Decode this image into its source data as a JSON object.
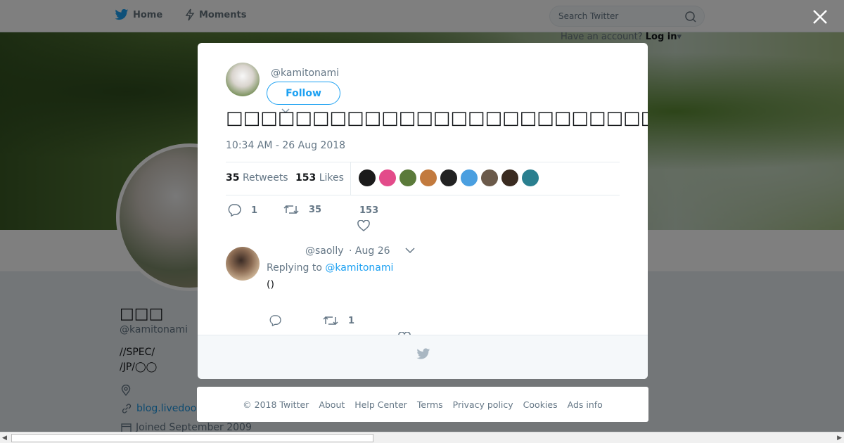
{
  "nav": {
    "home_label": "Home",
    "moments_label": "Moments",
    "search_placeholder": "Search Twitter",
    "have_account": "Have an account?",
    "login_label": "Log in"
  },
  "profile": {
    "name": "□□□",
    "handle": "@kamitonami",
    "bio_line1": " //SPEC/",
    "bio_line2": "/JP/◯◯",
    "link": "blog.livedoor",
    "joined": "Joined September 2009"
  },
  "tweet": {
    "handle": "@kamitonami",
    "follow_label": "Follow",
    "text": "□□□□□□□□□□□□□□□□□□□□□□□□□□□□□□□□□□□□□□□□□□□□□□□□□□□□□□□□□□□□□□□□□",
    "timestamp": "10:34 AM - 26 Aug 2018",
    "retweets_count": "35",
    "retweets_label": "Retweets",
    "likes_count": "153",
    "likes_label": "Likes",
    "reply_count": "1",
    "retweet_action_count": "35",
    "like_action_count": "153"
  },
  "liker_avatars": [
    "#1b1b1b",
    "#e34b8a",
    "#5b7a3a",
    "#c27a3e",
    "#222222",
    "#4a9fe0",
    "#6b5a4a",
    "#3a2b20",
    "#2a7f8f"
  ],
  "reply": {
    "handle": "@saolly",
    "time": "· Aug 26",
    "replying_to_prefix": "Replying to",
    "replying_to_handle": "@kamitonami",
    "text": "()",
    "retweet_count": "1"
  },
  "footer_links": [
    "© 2018 Twitter",
    "About",
    "Help Center",
    "Terms",
    "Privacy policy",
    "Cookies",
    "Ads info"
  ],
  "colors": {
    "accent": "#1da1f2",
    "muted": "#657786",
    "background": "#e6ecf0"
  }
}
